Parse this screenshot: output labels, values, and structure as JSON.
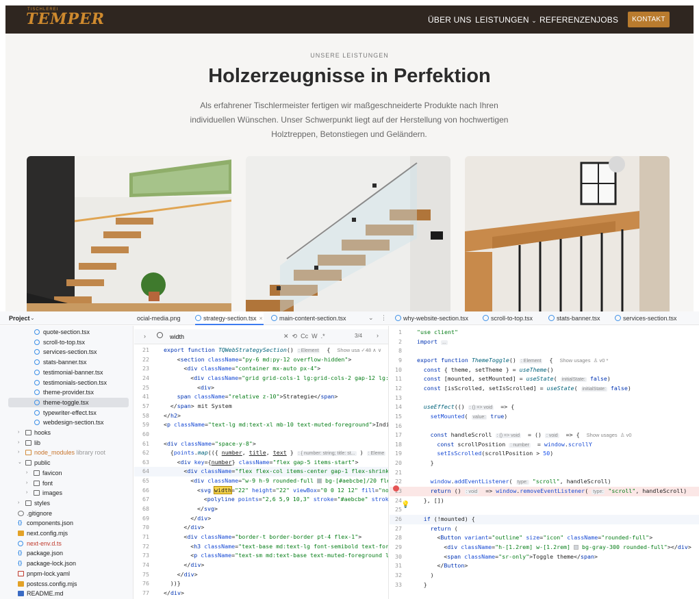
{
  "site": {
    "logo": "TEMPER",
    "logo_small": "TISCHLEREI",
    "nav": {
      "items": [
        "ÜBER UNS",
        "LEISTUNGEN",
        "REFERENZEN",
        "JOBS"
      ],
      "cta": "KONTAKT"
    },
    "eyebrow": "UNSERE LEISTUNGEN",
    "headline": "Holzerzeugnisse in Perfektion",
    "lead": "Als erfahrener Tischlermeister fertigen wir maßgeschneiderte Produkte nach Ihren individuellen Wünschen. Unser Schwerpunkt liegt auf der Herstellung von hochwertigen Holztreppen, Betonstiegen und Geländern."
  },
  "ide": {
    "project_label": "Project",
    "left_tabs": [
      {
        "label": "ocial-media.png",
        "active": false
      },
      {
        "label": "strategy-section.tsx",
        "active": true
      },
      {
        "label": "main-content-section.tsx",
        "active": false
      }
    ],
    "right_tabs": [
      {
        "label": "why-website-section.tsx"
      },
      {
        "label": "scroll-to-top.tsx"
      },
      {
        "label": "stats-banner.tsx"
      },
      {
        "label": "services-section.tsx"
      }
    ],
    "tree": [
      {
        "label": "quote-section.tsx",
        "kind": "ts",
        "depth": 3
      },
      {
        "label": "scroll-to-top.tsx",
        "kind": "ts",
        "depth": 3
      },
      {
        "label": "services-section.tsx",
        "kind": "ts",
        "depth": 3
      },
      {
        "label": "stats-banner.tsx",
        "kind": "ts",
        "depth": 3
      },
      {
        "label": "testimonial-banner.tsx",
        "kind": "ts",
        "depth": 3
      },
      {
        "label": "testimonials-section.tsx",
        "kind": "ts",
        "depth": 3
      },
      {
        "label": "theme-provider.tsx",
        "kind": "ts",
        "depth": 3
      },
      {
        "label": "theme-toggle.tsx",
        "kind": "ts",
        "depth": 3,
        "selected": true
      },
      {
        "label": "typewriter-effect.tsx",
        "kind": "ts",
        "depth": 3
      },
      {
        "label": "webdesign-section.tsx",
        "kind": "ts",
        "depth": 3
      },
      {
        "label": "hooks",
        "kind": "folder",
        "depth": 1,
        "arrow": "›"
      },
      {
        "label": "lib",
        "kind": "folder",
        "depth": 1,
        "arrow": "›"
      },
      {
        "label": "node_modules",
        "suffix": "library root",
        "kind": "folder-orange",
        "depth": 1,
        "arrow": "›",
        "color": "orange"
      },
      {
        "label": "public",
        "kind": "folder",
        "depth": 1,
        "arrow": "⌄"
      },
      {
        "label": "favicon",
        "kind": "folder",
        "depth": 2,
        "arrow": "›"
      },
      {
        "label": "font",
        "kind": "folder",
        "depth": 2,
        "arrow": "›"
      },
      {
        "label": "images",
        "kind": "folder",
        "depth": 2,
        "arrow": "›"
      },
      {
        "label": "styles",
        "kind": "folder",
        "depth": 1,
        "arrow": "›"
      },
      {
        "label": ".gitignore",
        "kind": "git",
        "depth": 1
      },
      {
        "label": "components.json",
        "kind": "json",
        "depth": 1
      },
      {
        "label": "next.config.mjs",
        "kind": "js",
        "depth": 1
      },
      {
        "label": "next-env.d.ts",
        "kind": "ts",
        "depth": 1,
        "color": "red"
      },
      {
        "label": "package.json",
        "kind": "json",
        "depth": 1
      },
      {
        "label": "package-lock.json",
        "kind": "json",
        "depth": 1
      },
      {
        "label": "pnpm-lock.yaml",
        "kind": "yaml",
        "depth": 1
      },
      {
        "label": "postcss.config.mjs",
        "kind": "js",
        "depth": 1
      },
      {
        "label": "README.md",
        "kind": "md",
        "depth": 1
      }
    ],
    "search": {
      "value": "width",
      "tools": "✕  ⟲  Cc  W  .*",
      "count": "3/4"
    },
    "left_code": [
      {
        "n": "21",
        "html": "<span class=\"k\">export function</span> <span class=\"fn\">TQWebStrategySection</span>() <span class=\"hint\">: Element</span>  {  <span class=\"usage\">Show usa ✓48 ∧ ∨</span>",
        "indent": 0
      },
      {
        "n": "22",
        "html": "&lt;<span class=\"tag\">section</span> <span class=\"attr\">className</span>=<span class=\"str\">\"py-6 md:py-12 overflow-hidden\"</span>&gt;",
        "indent": 2
      },
      {
        "n": "23",
        "html": "&lt;<span class=\"tag\">div</span> <span class=\"attr\">className</span>=<span class=\"str\">\"container mx-auto px-4\"</span>&gt;",
        "indent": 3
      },
      {
        "n": "24",
        "html": "&lt;<span class=\"tag\">div</span> <span class=\"attr\">className</span>=<span class=\"str\">\"grid grid-cols-1 lg:grid-cols-2 gap-12 lg:gap</span>",
        "indent": 4
      },
      {
        "n": "25",
        "html": "&lt;<span class=\"tag\">div</span>&gt;",
        "indent": 5
      },
      {
        "n": "41",
        "html": "<span class=\"tag\">span</span> <span class=\"attr\">className</span>=<span class=\"str\">\"relative z-10\"</span>&gt;Strategie&lt;/<span class=\"tag\">span</span>&gt;",
        "indent": 2
      },
      {
        "n": "57",
        "html": "&lt;/<span class=\"tag\">span</span>&gt; mit System",
        "indent": 1
      },
      {
        "n": "58",
        "html": "&lt;/<span class=\"tag\">h2</span>&gt;",
        "indent": 0
      },
      {
        "n": "59",
        "html": "&lt;<span class=\"tag\">p</span> <span class=\"attr\">className</span>=<span class=\"str\">\"text-lg md:text-xl mb-10 text-muted-foreground\"</span>&gt;Indiv",
        "indent": 0
      },
      {
        "n": "60",
        "html": "",
        "indent": 0
      },
      {
        "n": "61",
        "html": "&lt;<span class=\"tag\">div</span> <span class=\"attr\">className</span>=<span class=\"str\">\"space-y-8\"</span>&gt;",
        "indent": 0
      },
      {
        "n": "62",
        "html": "{<span class=\"attr\">points</span>.<span class=\"fn\">map</span>(({ <span class=\"u\">number</span>, <span class=\"u\">title</span>, <span class=\"u\">text</span> } <span class=\"hint\">: { number: string; title: st...</span> ) <span class=\"hint\">: Eleme</span>",
        "indent": 1
      },
      {
        "n": "63",
        "html": "&lt;<span class=\"tag\">div</span> <span class=\"attr\">key</span>={<span class=\"u\">number</span>} <span class=\"attr\">className</span>=<span class=\"str\">\"flex gap-5 items-start\"</span>&gt;",
        "indent": 2
      },
      {
        "n": "64",
        "html": "&lt;<span class=\"tag\">div</span> <span class=\"attr\">className</span>=<span class=\"str\">\"flex flex-col items-center gap-1 flex-shrink-</span>",
        "indent": 3,
        "hl": true
      },
      {
        "n": "65",
        "html": "&lt;<span class=\"tag\">div</span> <span class=\"attr\">className</span>=<span class=\"str\">\"w-9 h-9 rounded-full <span class=\"sw\" style=\"background:#aebcbe\"></span> bg-[#aebcbe]/20 flex</span>",
        "indent": 4
      },
      {
        "n": "66",
        "html": "&lt;<span class=\"tag\">svg</span> <span class=\"match\">width</span>=<span class=\"str\">\"22\"</span> <span class=\"attr\">height</span>=<span class=\"str\">\"22\"</span> <span class=\"attr\">viewBox</span>=<span class=\"str\">\"0 0 12 12\"</span> <span class=\"attr\">fill</span>=<span class=\"str\">\"non</span>",
        "indent": 5
      },
      {
        "n": "67",
        "html": "&lt;<span class=\"tag\">polyline</span> <span class=\"attr\">points</span>=<span class=\"str\">\"2,6 5,9 10,3\"</span> <span class=\"attr\">stroke</span>=<span class=\"str\">\"#aebcbe\"</span> <span class=\"attr\">stroke</span>",
        "indent": 6
      },
      {
        "n": "68",
        "html": "&lt;/<span class=\"tag\">svg</span>&gt;",
        "indent": 5
      },
      {
        "n": "69",
        "html": "&lt;/<span class=\"tag\">div</span>&gt;",
        "indent": 4
      },
      {
        "n": "70",
        "html": "&lt;/<span class=\"tag\">div</span>&gt;",
        "indent": 3
      },
      {
        "n": "71",
        "html": "&lt;<span class=\"tag\">div</span> <span class=\"attr\">className</span>=<span class=\"str\">\"border-t border-border pt-4 flex-1\"</span>&gt;",
        "indent": 3
      },
      {
        "n": "72",
        "html": "&lt;<span class=\"tag\">h3</span> <span class=\"attr\">className</span>=<span class=\"str\">\"text-base md:text-lg font-semibold text-fore</span>",
        "indent": 4
      },
      {
        "n": "73",
        "html": "&lt;<span class=\"tag\">p</span> <span class=\"attr\">className</span>=<span class=\"str\">\"text-sm md:text-base text-muted-foreground le</span>",
        "indent": 4
      },
      {
        "n": "74",
        "html": "&lt;/<span class=\"tag\">div</span>&gt;",
        "indent": 3
      },
      {
        "n": "75",
        "html": "&lt;/<span class=\"tag\">div</span>&gt;",
        "indent": 2
      },
      {
        "n": "76",
        "html": "))}",
        "indent": 1
      },
      {
        "n": "77",
        "html": "&lt;/<span class=\"tag\">div</span>&gt;",
        "indent": 0
      }
    ],
    "right_code": [
      {
        "n": "1",
        "html": "<span class=\"str\">\"use client\"</span>",
        "indent": 0
      },
      {
        "n": "2",
        "html": "<span class=\"k\">import</span> <span class=\"hint\">...</span>",
        "indent": 0
      },
      {
        "n": "8",
        "html": "",
        "indent": 0
      },
      {
        "n": "9",
        "html": "<span class=\"k\">export function</span> <span class=\"fn\">ThemeToggle</span>() <span class=\"hint\">: Element</span>  {  <span class=\"usage\">Show usages  ♙ v0 *</span>",
        "indent": 0
      },
      {
        "n": "10",
        "html": "<span class=\"k\">const</span> { theme, setTheme } = <span class=\"fn\">useTheme</span>()",
        "indent": 1
      },
      {
        "n": "11",
        "html": "<span class=\"k\">const</span> [mounted, setMounted] = <span class=\"fn\">useState</span>( <span class=\"hint\">initialState:</span> <span class=\"k\">false</span>)",
        "indent": 1
      },
      {
        "n": "12",
        "html": "<span class=\"k\">const</span> [isScrolled, setIsScrolled] = <span class=\"fn\">useState</span>( <span class=\"hint\">initialState:</span> <span class=\"k\">false</span>)",
        "indent": 1
      },
      {
        "n": "13",
        "html": "",
        "indent": 0
      },
      {
        "n": "14",
        "html": "<span class=\"fn\">useEffect</span>(() <span class=\"hint\">: () =&gt; void</span>  =&gt; {",
        "indent": 1
      },
      {
        "n": "15",
        "html": "<span class=\"attr\">setMounted</span>( <span class=\"hint\">value:</span> <span class=\"k\">true</span>)",
        "indent": 2
      },
      {
        "n": "16",
        "html": "",
        "indent": 0
      },
      {
        "n": "17",
        "html": "<span class=\"k\">const</span> handleScroll <span class=\"hint\">: () =&gt; void</span>  = () <span class=\"hint\">: void</span>  =&gt; {  <span class=\"usage\">Show usages  ♙ v0</span>",
        "indent": 2
      },
      {
        "n": "18",
        "html": "<span class=\"k\">const</span> scrollPosition <span class=\"hint\">: number</span>  = <span class=\"attr\">window</span>.<span class=\"attr\">scrollY</span>",
        "indent": 3
      },
      {
        "n": "19",
        "html": "<span class=\"attr\">setIsScrolled</span>(scrollPosition &gt; <span class=\"num\">50</span>)",
        "indent": 3
      },
      {
        "n": "20",
        "html": "}",
        "indent": 2
      },
      {
        "n": "21",
        "html": "",
        "indent": 0
      },
      {
        "n": "22",
        "html": "<span class=\"attr\">window</span>.<span class=\"attr\">addEventListener</span>( <span class=\"hint\">type:</span> <span class=\"str\">\"scroll\"</span>, handleScroll)",
        "indent": 2
      },
      {
        "n": "23",
        "html": "<span class=\"k\">return</span> () <span class=\"hint\">: void</span>  =&gt; <span class=\"attr\">window</span>.<span class=\"attr\">removeEventListener</span>( <span class=\"hint\">type:</span> <span class=\"str\">\"scroll\"</span>, handleScroll)",
        "indent": 2,
        "err": true
      },
      {
        "n": "24",
        "html": "}, [])",
        "indent": 1
      },
      {
        "n": "25",
        "html": "",
        "indent": 0
      },
      {
        "n": "26",
        "html": "<span class=\"k\">if</span> (!mounted) {",
        "indent": 1,
        "hl": true
      },
      {
        "n": "27",
        "html": "<span class=\"k\">return</span> (",
        "indent": 2
      },
      {
        "n": "28",
        "html": "&lt;<span class=\"tag\">Button</span> <span class=\"attr\">variant</span>=<span class=\"str\">\"outline\"</span> <span class=\"attr\">size</span>=<span class=\"str\">\"icon\"</span> <span class=\"attr\">className</span>=<span class=\"str\">\"rounded-full\"</span>&gt;",
        "indent": 3
      },
      {
        "n": "29",
        "html": "&lt;<span class=\"tag\">div</span> <span class=\"attr\">className</span>=<span class=\"str\">\"h-[1.2rem] w-[1.2rem] <span class=\"sw\" style=\"background:#d1d5db\"></span> bg-gray-300 rounded-full\"</span>&gt;&lt;/<span class=\"tag\">div</span>&gt;",
        "indent": 4
      },
      {
        "n": "30",
        "html": "&lt;<span class=\"tag\">span</span> <span class=\"attr\">className</span>=<span class=\"str\">\"sr-only\"</span>&gt;Toggle theme&lt;/<span class=\"tag\">span</span>&gt;",
        "indent": 4
      },
      {
        "n": "31",
        "html": "&lt;/<span class=\"tag\">Button</span>&gt;",
        "indent": 3
      },
      {
        "n": "32",
        "html": ")",
        "indent": 2
      },
      {
        "n": "33",
        "html": "}",
        "indent": 1
      }
    ]
  },
  "colors": {
    "nav_bg": "#2f2620",
    "brand": "#b97b2e",
    "accent_blue": "#3d7cf0"
  }
}
